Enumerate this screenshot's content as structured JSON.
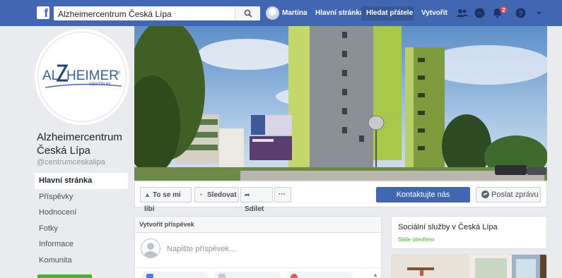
{
  "topbar": {
    "search_value": "Alzheimercentrum Česká Lípa",
    "user_name": "Martina",
    "nav": [
      "Hlavní stránka",
      "Hledat přátele",
      "Vytvořit"
    ],
    "notification_count": "2",
    "brand_color": "#4267b2"
  },
  "page": {
    "logo_text": "ALZHEIMER",
    "logo_sub": "CENTRUM",
    "name": "Alzheimercentrum Česká Lípa",
    "handle": "@centrumceskalipa"
  },
  "sidebar": {
    "items": [
      {
        "label": "Hlavní stránka",
        "active": true
      },
      {
        "label": "Příspěvky"
      },
      {
        "label": "Hodnocení"
      },
      {
        "label": "Fotky"
      },
      {
        "label": "Informace"
      },
      {
        "label": "Komunita"
      }
    ]
  },
  "actions": {
    "like": "To se mi líbí",
    "follow": "Sledovat",
    "share": "Sdílet",
    "more": "···",
    "contact": "Kontaktujte nás",
    "message": "Poslat zprávu"
  },
  "create_post": {
    "title": "Vytvořit příspěvek",
    "placeholder": "Napište příspěvek..."
  },
  "info_card": {
    "title": "Sociální služby v Česká Lípa",
    "status": "Stále otevřeno"
  }
}
